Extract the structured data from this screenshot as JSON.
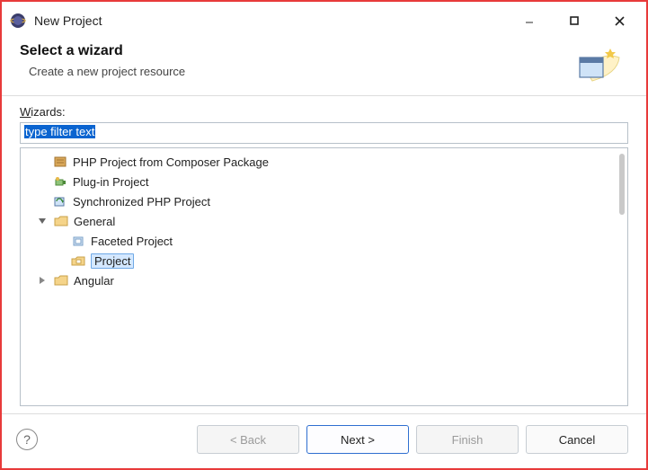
{
  "titlebar": {
    "title": "New Project"
  },
  "header": {
    "title": "Select a wizard",
    "subtitle": "Create a new project resource"
  },
  "wizards": {
    "label": "Wizards:",
    "filter_text": "type filter text"
  },
  "tree": {
    "expanded": [
      "General"
    ],
    "selected": "Project",
    "items": [
      {
        "label": "PHP Project from Composer Package",
        "depth": 1,
        "icon": "php-package-icon"
      },
      {
        "label": "Plug-in Project",
        "depth": 1,
        "icon": "plugin-icon"
      },
      {
        "label": "Synchronized PHP Project",
        "depth": 1,
        "icon": "sync-php-icon"
      },
      {
        "label": "General",
        "depth": 0,
        "icon": "folder-icon",
        "expandable": true,
        "expanded": true
      },
      {
        "label": "Faceted Project",
        "depth": 1,
        "icon": "faceted-icon",
        "parent": "General"
      },
      {
        "label": "Project",
        "depth": 1,
        "icon": "project-icon",
        "parent": "General",
        "selected": true
      },
      {
        "label": "Angular",
        "depth": 0,
        "icon": "folder-icon",
        "expandable": true,
        "expanded": false
      }
    ]
  },
  "buttons": {
    "back": "< Back",
    "next": "Next >",
    "finish": "Finish",
    "cancel": "Cancel"
  }
}
